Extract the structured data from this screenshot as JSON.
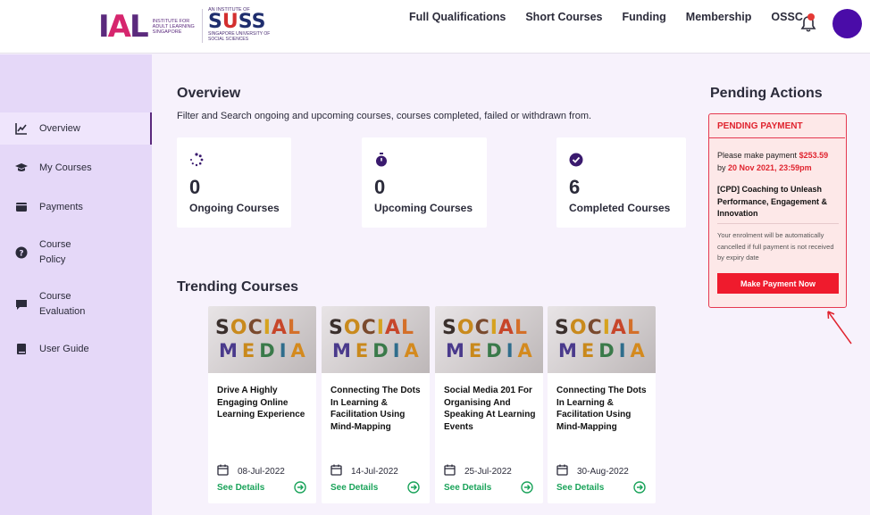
{
  "header": {
    "logo_ial": {
      "mark": "IAL",
      "text": "Institute for Adult Learning Singapore"
    },
    "logo_suss": {
      "pre": "An Institute of",
      "name": "SUSS",
      "post": "Singapore University of Social Sciences"
    },
    "nav": [
      "Full Qualifications",
      "Short Courses",
      "Funding",
      "Membership",
      "OSSC"
    ],
    "bell_icon": "bell-icon",
    "avatar_color": "#4a0ca8"
  },
  "sidebar": {
    "items": [
      {
        "label": "Overview",
        "icon": "chart-line-icon"
      },
      {
        "label": "My Courses",
        "icon": "graduation-cap-icon"
      },
      {
        "label": "Payments",
        "icon": "wallet-icon"
      },
      {
        "label": "Course Policy",
        "icon": "question-circle-icon"
      },
      {
        "label": "Course Evaluation",
        "icon": "comment-icon"
      },
      {
        "label": "User Guide",
        "icon": "book-icon"
      }
    ]
  },
  "overview": {
    "title": "Overview",
    "subtitle": "Filter and Search ongoing and upcoming courses, courses completed, failed or withdrawn from.",
    "stats": [
      {
        "value": "0",
        "label": "Ongoing Courses",
        "icon": "spinner-icon"
      },
      {
        "value": "0",
        "label": "Upcoming Courses",
        "icon": "stopwatch-icon"
      },
      {
        "value": "6",
        "label": "Completed Courses",
        "icon": "check-circle-icon"
      }
    ]
  },
  "trending": {
    "title": "Trending Courses",
    "thumb_line1": "SOCIAL",
    "thumb_line2": "MEDIA",
    "cards": [
      {
        "title": "Drive A Highly Engaging Online Learning Experience",
        "date": "08-Jul-2022",
        "link": "See Details"
      },
      {
        "title": "Connecting The Dots In Learning & Facilitation Using Mind-Mapping",
        "date": "14-Jul-2022",
        "link": "See Details"
      },
      {
        "title": "Social Media 201 For Organising And Speaking At Learning Events",
        "date": "25-Jul-2022",
        "link": "See Details"
      },
      {
        "title": "Connecting The Dots In Learning & Facilitation Using Mind-Mapping",
        "date": "30-Aug-2022",
        "link": "See Details"
      }
    ]
  },
  "pending": {
    "title": "Pending Actions",
    "header": "PENDING PAYMENT",
    "pay_prefix": "Please make payment",
    "amount": "$253.59",
    "by": "by",
    "deadline": "20 Nov 2021, 23:59pm",
    "course": "[CPD] Coaching to Unleash Performance, Engagement & Innovation",
    "note": "Your enrolment will be automatically cancelled if full payment is not received by expiry date",
    "button": "Make Payment Now"
  }
}
